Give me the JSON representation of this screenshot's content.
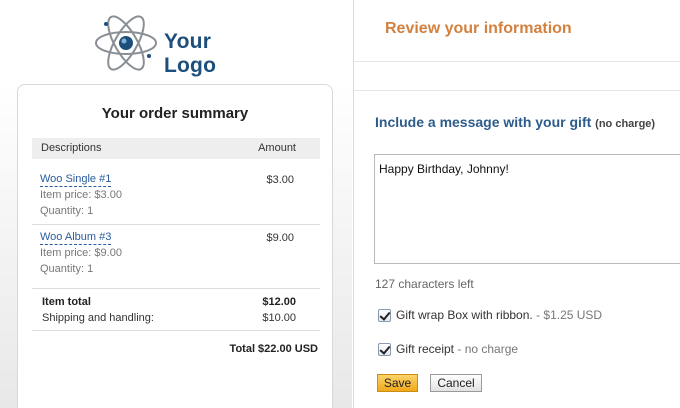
{
  "logo": {
    "text": "Your Logo",
    "icon": "atom-icon"
  },
  "summary": {
    "title": "Your order summary",
    "columns": {
      "description": "Descriptions",
      "amount": "Amount"
    },
    "items": [
      {
        "name": "Woo Single #1",
        "price": "Item price: $3.00",
        "quantity": "Quantity: 1",
        "amount": "$3.00"
      },
      {
        "name": "Woo Album #3",
        "price": "Item price: $9.00",
        "quantity": "Quantity: 1",
        "amount": "$9.00"
      }
    ],
    "item_total_label": "Item total",
    "item_total_value": "$12.00",
    "shipping_label": "Shipping and handling:",
    "shipping_value": "$10.00",
    "grand_total": "Total $22.00 USD"
  },
  "review": {
    "title": "Review your information"
  },
  "gift": {
    "heading": "Include a message with your gift",
    "heading_note": "(no charge)",
    "message": "Happy Birthday, Johnny!",
    "chars_left": "127 characters left",
    "wrap_label": "Gift wrap Box with ribbon.",
    "wrap_price": " - $1.25 USD",
    "wrap_checked": true,
    "receipt_label": "Gift receipt",
    "receipt_note": " - no charge",
    "receipt_checked": true,
    "save_label": "Save",
    "cancel_label": "Cancel"
  },
  "colors": {
    "accent_orange": "#d2813f",
    "heading_blue": "#2e5c8a",
    "link_blue": "#2a5d9f",
    "save_button": "#f0a81a"
  }
}
